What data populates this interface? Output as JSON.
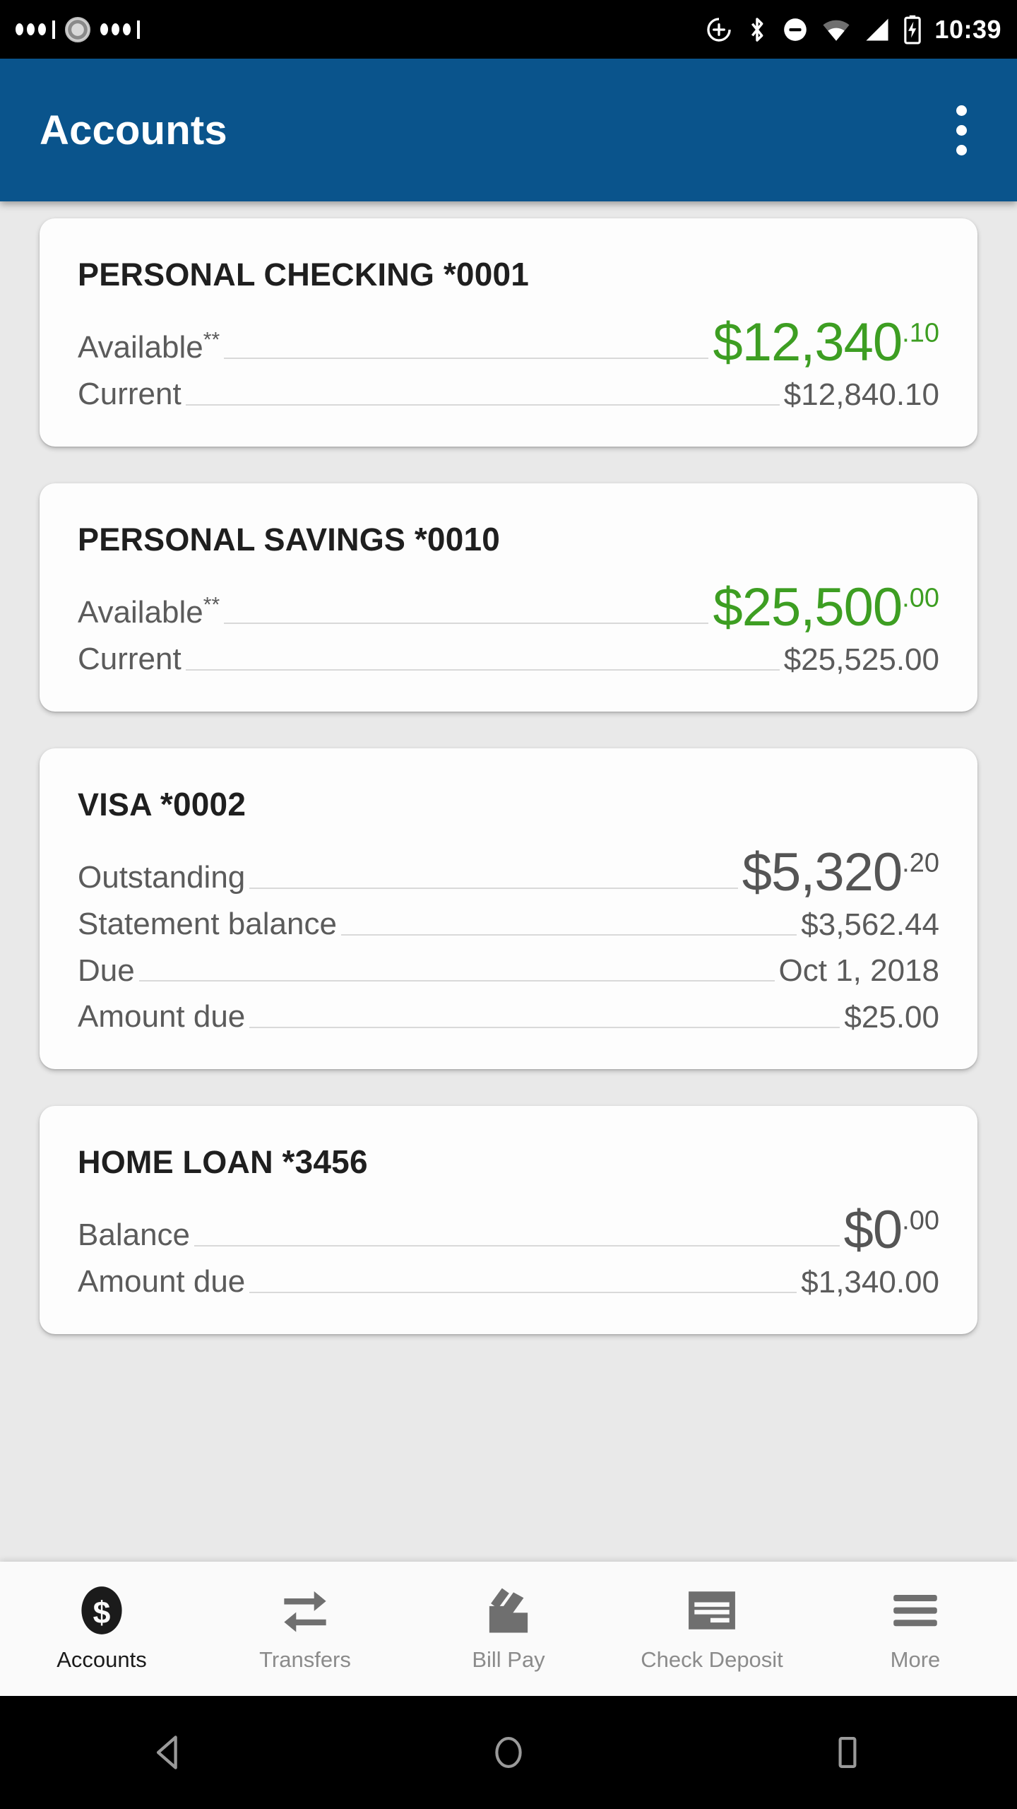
{
  "status_bar": {
    "time": "10:39",
    "left_icons": [
      "notification-dots-icon",
      "sync-gear-icon",
      "notification-dots-icon"
    ],
    "right_icons": [
      "location-add-icon",
      "bluetooth-icon",
      "do-not-disturb-icon",
      "wifi-icon",
      "cellular-signal-icon",
      "battery-charging-icon"
    ],
    "background": "#000000"
  },
  "app_bar": {
    "title": "Accounts",
    "overflow_menu": "more-options",
    "background": "#0a548c",
    "text_color": "#ffffff"
  },
  "theme": {
    "accent_green": "#3d9e22",
    "label_gray": "#5b5b5b",
    "title_dark": "#1f1f1f",
    "page_background": "#e9e9e9",
    "card_background": "#fdfdfd"
  },
  "accounts": [
    {
      "name": "PERSONAL CHECKING",
      "mask": "*0001",
      "hero": {
        "label": "Available",
        "footnote": "**",
        "whole": "$12,340",
        "cents": ".10",
        "color": "green"
      },
      "rows": [
        {
          "label": "Current",
          "value": "$12,840.10"
        }
      ]
    },
    {
      "name": "PERSONAL SAVINGS",
      "mask": "*0010",
      "hero": {
        "label": "Available",
        "footnote": "**",
        "whole": "$25,500",
        "cents": ".00",
        "color": "green"
      },
      "rows": [
        {
          "label": "Current",
          "value": "$25,525.00"
        }
      ]
    },
    {
      "name": "VISA",
      "mask": "*0002",
      "hero": {
        "label": "Outstanding",
        "footnote": "",
        "whole": "$5,320",
        "cents": ".20",
        "color": "dark"
      },
      "rows": [
        {
          "label": "Statement balance",
          "value": "$3,562.44"
        },
        {
          "label": "Due",
          "value": "Oct 1, 2018"
        },
        {
          "label": "Amount due",
          "value": "$25.00"
        }
      ]
    },
    {
      "name": "HOME LOAN",
      "mask": "*3456",
      "hero": {
        "label": "Balance",
        "footnote": "",
        "whole": "$0",
        "cents": ".00",
        "color": "dark"
      },
      "rows": [
        {
          "label": "Amount due",
          "value": "$1,340.00"
        }
      ]
    }
  ],
  "tab_bar": {
    "items": [
      {
        "label": "Accounts",
        "icon": "dollar-coin-icon",
        "active": true
      },
      {
        "label": "Transfers",
        "icon": "transfer-arrows-icon",
        "active": false
      },
      {
        "label": "Bill Pay",
        "icon": "bill-tray-icon",
        "active": false
      },
      {
        "label": "Check Deposit",
        "icon": "check-icon",
        "active": false
      },
      {
        "label": "More",
        "icon": "hamburger-menu-icon",
        "active": false
      }
    ]
  },
  "android_nav": {
    "back": "back-triangle-icon",
    "home": "home-circle-icon",
    "recents": "recents-square-icon"
  }
}
